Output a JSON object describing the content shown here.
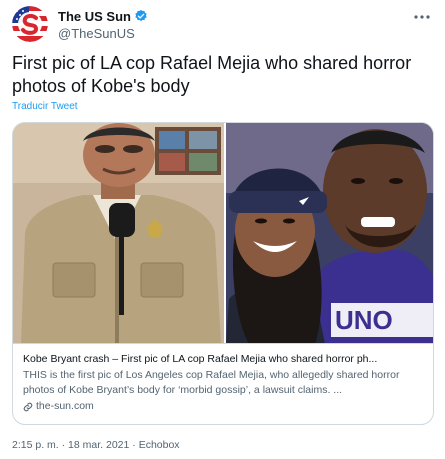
{
  "tweet": {
    "author": {
      "display_name": "The US Sun",
      "handle": "@TheSunUS",
      "verified_icon": "verified-badge-icon",
      "avatar_icon": "the-us-sun-logo",
      "more_icon": "more-options-icon"
    },
    "text": "First pic of LA cop Rafael Mejia who shared horror photos of Kobe's body",
    "translate_label": "Traducir Tweet",
    "card": {
      "title": "Kobe Bryant crash – First pic of LA cop Rafael Mejia who shared horror ph...",
      "description": "THIS is the first pic of Los Angeles cop Rafael Mejia, who allegedly shared horror photos of Kobe Bryant’s body for ‘morbid gossip’, a lawsuit claims. ...",
      "domain": "the-sun.com",
      "link_icon": "link-icon",
      "jersey_text": "UNO"
    },
    "time": "2:15 p. m.",
    "separator": "·",
    "date": "18 mar. 2021",
    "source": "Echobox"
  },
  "colors": {
    "accent": "#1d9bf0",
    "text_primary": "#0f1419",
    "text_secondary": "#536471",
    "border": "#cfd9de",
    "brand_red": "#d8262e"
  }
}
